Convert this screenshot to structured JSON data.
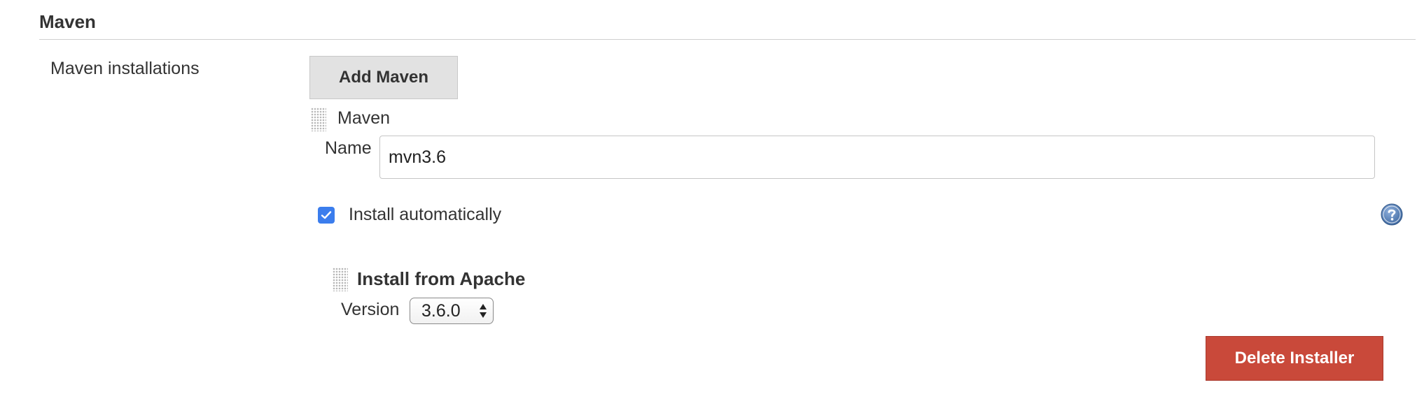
{
  "section": {
    "title": "Maven"
  },
  "maven_installations": {
    "label": "Maven installations",
    "add_button_label": "Add Maven",
    "entry": {
      "heading": "Maven",
      "name_label": "Name",
      "name_value": "mvn3.6",
      "install_automatically": {
        "label": "Install automatically",
        "checked": true
      },
      "help_icon": "question-mark-icon",
      "installer": {
        "heading": "Install from Apache",
        "version_label": "Version",
        "version_selected": "3.6.0",
        "delete_button_label": "Delete Installer"
      }
    }
  },
  "colors": {
    "checkbox": "#3b7ded",
    "delete_button": "#c9493a",
    "help_icon": "#4a77b4",
    "add_button_bg": "#e2e2e2"
  }
}
